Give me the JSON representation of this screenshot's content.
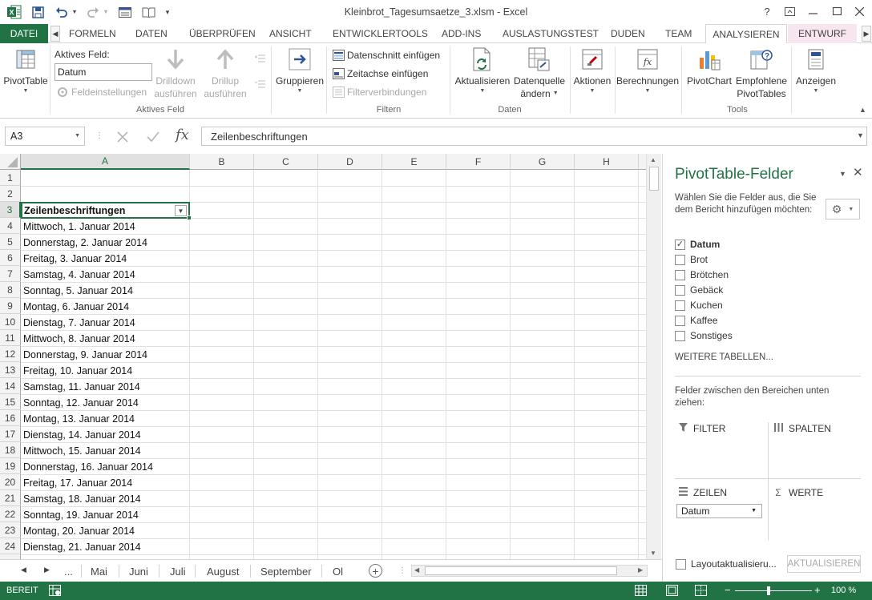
{
  "window": {
    "title": "Kleinbrot_Tagesumsaetze_3.xlsm - Excel",
    "help": "?"
  },
  "tabs": {
    "file": "DATEI",
    "items": [
      "FORMELN",
      "DATEN",
      "ÜBERPRÜFEN",
      "ANSICHT",
      "ENTWICKLERTOOLS",
      "ADD-INS",
      "AUSLASTUNGSTEST",
      "DUDEN",
      "TEAM"
    ],
    "context_active": "ANALYSIEREN",
    "context_other": "ENTWURF"
  },
  "ribbon": {
    "pivottable": "PivotTable",
    "active_field_label": "Aktives Feld:",
    "active_field_value": "Datum",
    "field_settings": "Feldeinstellungen",
    "drilldown_1": "Drilldown",
    "drilldown_2": "ausführen",
    "drillup_1": "Drillup",
    "drillup_2": "ausführen",
    "group_active_field": "Aktives Feld",
    "group_btn": "Gruppieren",
    "slicer": "Datenschnitt einfügen",
    "timeline": "Zeitachse einfügen",
    "filter_connections": "Filterverbindungen",
    "group_filter": "Filtern",
    "refresh": "Aktualisieren",
    "datasource_1": "Datenquelle",
    "datasource_2": "ändern",
    "group_data": "Daten",
    "actions": "Aktionen",
    "calculations": "Berechnungen",
    "pivotchart": "PivotChart",
    "recommended_1": "Empfohlene",
    "recommended_2": "PivotTables",
    "group_tools": "Tools",
    "show": "Anzeigen"
  },
  "formula_bar": {
    "name_box": "A3",
    "fx": "fx",
    "content": "Zeilenbeschriftungen"
  },
  "grid": {
    "columns": [
      "A",
      "B",
      "C",
      "D",
      "E",
      "F",
      "G",
      "H"
    ],
    "rows": [
      "1",
      "2",
      "3",
      "4",
      "5",
      "6",
      "7",
      "8",
      "9",
      "10",
      "11",
      "12",
      "13",
      "14",
      "15",
      "16",
      "17",
      "18",
      "19",
      "20",
      "21",
      "22",
      "23",
      "24"
    ],
    "header_cell": "Zeilenbeschriftungen",
    "dates": [
      "Mittwoch, 1. Januar 2014",
      "Donnerstag, 2. Januar 2014",
      "Freitag, 3. Januar 2014",
      "Samstag, 4. Januar 2014",
      "Sonntag, 5. Januar 2014",
      "Montag, 6. Januar 2014",
      "Dienstag, 7. Januar 2014",
      "Mittwoch, 8. Januar 2014",
      "Donnerstag, 9. Januar 2014",
      "Freitag, 10. Januar 2014",
      "Samstag, 11. Januar 2014",
      "Sonntag, 12. Januar 2014",
      "Montag, 13. Januar 2014",
      "Dienstag, 14. Januar 2014",
      "Mittwoch, 15. Januar 2014",
      "Donnerstag, 16. Januar 2014",
      "Freitag, 17. Januar 2014",
      "Samstag, 18. Januar 2014",
      "Sonntag, 19. Januar 2014",
      "Montag, 20. Januar 2014",
      "Dienstag, 21. Januar 2014"
    ]
  },
  "sheets": {
    "ellipsis": "...",
    "items": [
      "Mai",
      "Juni",
      "Juli",
      "August",
      "September",
      "Ol"
    ]
  },
  "status": {
    "ready": "BEREIT",
    "zoom": "100 %"
  },
  "pane": {
    "title": "PivotTable-Felder",
    "description": "Wählen Sie die Felder aus, die Sie dem Bericht hinzufügen möchten:",
    "fields": [
      {
        "label": "Datum",
        "checked": true
      },
      {
        "label": "Brot",
        "checked": false
      },
      {
        "label": "Brötchen",
        "checked": false
      },
      {
        "label": "Gebäck",
        "checked": false
      },
      {
        "label": "Kuchen",
        "checked": false
      },
      {
        "label": "Kaffee",
        "checked": false
      },
      {
        "label": "Sonstiges",
        "checked": false
      }
    ],
    "more_tables": "WEITERE TABELLEN...",
    "drag_desc": "Felder zwischen den Bereichen unten ziehen:",
    "filter": "FILTER",
    "columns": "SPALTEN",
    "rows": "ZEILEN",
    "values": "WERTE",
    "rows_field": "Datum",
    "defer": "Layoutaktualisieru...",
    "update": "AKTUALISIEREN"
  },
  "colors": {
    "accent": "#217346",
    "context_tab": "#f7e6ef"
  }
}
